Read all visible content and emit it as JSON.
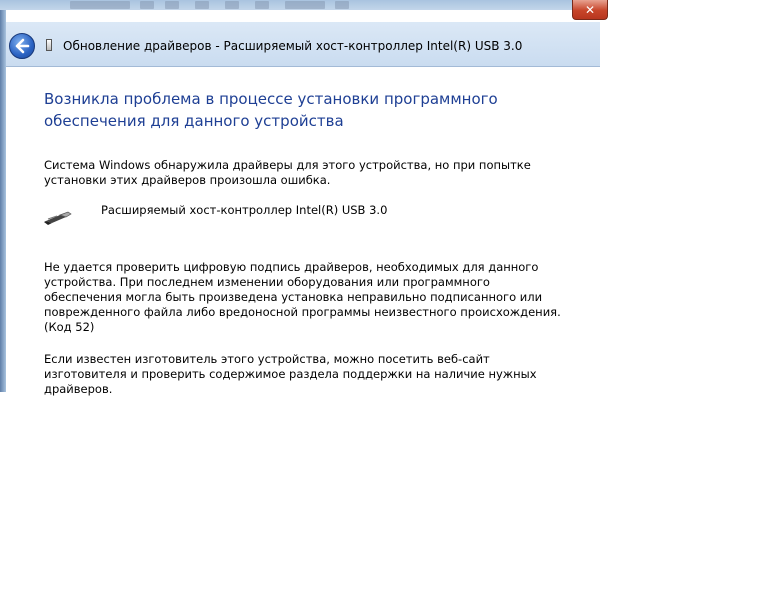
{
  "background_window": {
    "ghost_items": 8
  },
  "window": {
    "close_glyph": "✕",
    "title": "Обновление драйверов - Расширяемый хост-контроллер Intel(R) USB 3.0"
  },
  "content": {
    "heading": "Возникла проблема в процессе установки программного обеспечения для данного устройства",
    "intro": "Система Windows обнаружила драйверы для этого устройства, но при попытке установки этих драйверов произошла ошибка.",
    "device": {
      "name": "Расширяемый хост-контроллер Intel(R) USB 3.0",
      "icon": "usb-plug-icon"
    },
    "error_message": "Не удается проверить цифровую подпись драйверов, необходимых для данного устройства. При последнем изменении оборудования или программного обеспечения могла быть произведена установка неправильно подписанного или поврежденного файла либо вредоносной программы неизвестного происхождения. (Код 52)",
    "advice": "Если известен изготовитель этого устройства, можно посетить веб-сайт изготовителя и проверить содержимое раздела поддержки на наличие нужных драйверов."
  },
  "colors": {
    "heading": "#1e3f94",
    "title_bar": "#cadcf0",
    "close_button": "#c7452a"
  }
}
